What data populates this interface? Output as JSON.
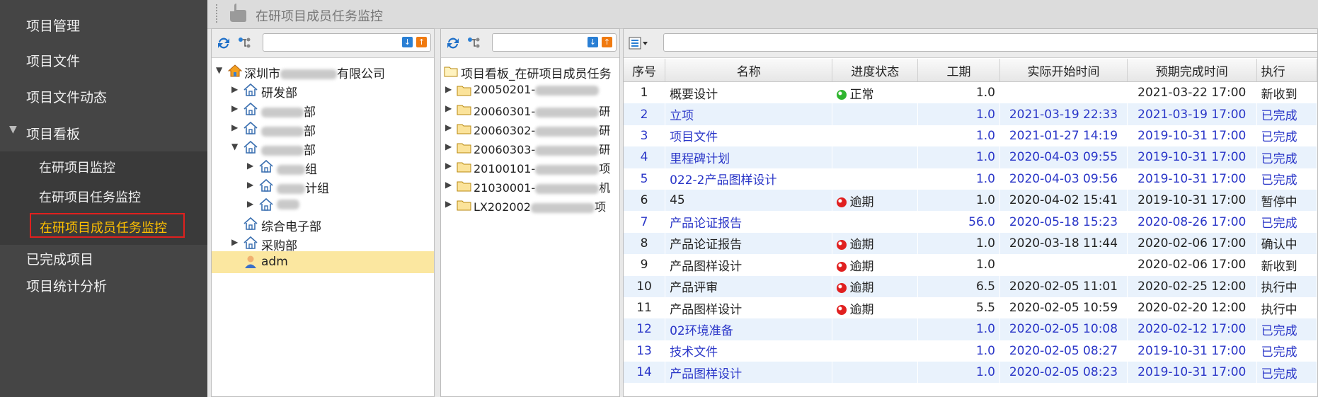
{
  "sidebar": {
    "items": [
      {
        "label": "项目管理"
      },
      {
        "label": "项目文件"
      },
      {
        "label": "项目文件动态"
      },
      {
        "label": "项目看板"
      },
      {
        "label": "已完成项目"
      },
      {
        "label": "项目统计分析"
      }
    ],
    "sub_items": [
      {
        "label": "在研项目监控"
      },
      {
        "label": "在研项目任务监控"
      },
      {
        "label": "在研项目成员任务监控"
      }
    ]
  },
  "titlebar": {
    "title": "在研项目成员任务监控"
  },
  "org_tree": {
    "root": "深圳市",
    "root_suffix": "有限公司",
    "nodes": [
      {
        "label": "研发部"
      },
      {
        "label": "部"
      },
      {
        "label": "部"
      },
      {
        "label": "部"
      },
      {
        "label": "组"
      },
      {
        "label": "计组"
      },
      {
        "label": ""
      },
      {
        "label": "综合电子部"
      },
      {
        "label": "采购部"
      },
      {
        "label": "adm"
      }
    ]
  },
  "project_tree": {
    "root": "项目看板_在研项目成员任务",
    "folders": [
      {
        "code": "20050201-",
        "suffix": ""
      },
      {
        "code": "20060301-",
        "suffix": "研"
      },
      {
        "code": "20060302-",
        "suffix": "研"
      },
      {
        "code": "20060303-",
        "suffix": "研"
      },
      {
        "code": "20100101-",
        "suffix": "项"
      },
      {
        "code": "21030001-",
        "suffix": "机"
      },
      {
        "code": "LX202002",
        "suffix": "项"
      }
    ]
  },
  "table": {
    "headers": [
      "序号",
      "名称",
      "进度状态",
      "工期",
      "实际开始时间",
      "预期完成时间",
      "执行"
    ],
    "rows": [
      {
        "no": "1",
        "name": "概要设计",
        "status": "正常",
        "status_color": "#2fb52f",
        "days": "1.0",
        "start": "",
        "due": "2021-03-22 17:00",
        "exec": "新收到",
        "done": false
      },
      {
        "no": "2",
        "name": "立项",
        "status": "",
        "status_color": "",
        "days": "1.0",
        "start": "2021-03-19 22:33",
        "due": "2021-03-19 17:00",
        "exec": "已完成",
        "done": true
      },
      {
        "no": "3",
        "name": "项目文件",
        "status": "",
        "status_color": "",
        "days": "1.0",
        "start": "2021-01-27 14:19",
        "due": "2019-10-31 17:00",
        "exec": "已完成",
        "done": true
      },
      {
        "no": "4",
        "name": "里程碑计划",
        "status": "",
        "status_color": "",
        "days": "1.0",
        "start": "2020-04-03 09:55",
        "due": "2019-10-31 17:00",
        "exec": "已完成",
        "done": true
      },
      {
        "no": "5",
        "name": "022-2产品图样设计",
        "status": "",
        "status_color": "",
        "days": "1.0",
        "start": "2020-04-03 09:56",
        "due": "2019-10-31 17:00",
        "exec": "已完成",
        "done": true
      },
      {
        "no": "6",
        "name": "45",
        "status": "逾期",
        "status_color": "#e02020",
        "days": "1.0",
        "start": "2020-04-02 15:41",
        "due": "2019-10-31 17:00",
        "exec": "暂停中",
        "done": false
      },
      {
        "no": "7",
        "name": "产品论证报告",
        "status": "",
        "status_color": "",
        "days": "56.0",
        "start": "2020-05-18 15:23",
        "due": "2020-08-26 17:00",
        "exec": "已完成",
        "done": true
      },
      {
        "no": "8",
        "name": "产品论证报告",
        "status": "逾期",
        "status_color": "#e02020",
        "days": "1.0",
        "start": "2020-03-18 11:44",
        "due": "2020-02-06 17:00",
        "exec": "确认中",
        "done": false
      },
      {
        "no": "9",
        "name": "产品图样设计",
        "status": "逾期",
        "status_color": "#e02020",
        "days": "1.0",
        "start": "",
        "due": "2020-02-06 17:00",
        "exec": "新收到",
        "done": false
      },
      {
        "no": "10",
        "name": "产品评审",
        "status": "逾期",
        "status_color": "#e02020",
        "days": "6.5",
        "start": "2020-02-05 11:01",
        "due": "2020-02-25 12:00",
        "exec": "执行中",
        "done": false
      },
      {
        "no": "11",
        "name": "产品图样设计",
        "status": "逾期",
        "status_color": "#e02020",
        "days": "5.5",
        "start": "2020-02-05 10:59",
        "due": "2020-02-20 12:00",
        "exec": "执行中",
        "done": false
      },
      {
        "no": "12",
        "name": "02环境准备",
        "status": "",
        "status_color": "",
        "days": "1.0",
        "start": "2020-02-05 10:08",
        "due": "2020-02-12 17:00",
        "exec": "已完成",
        "done": true
      },
      {
        "no": "13",
        "name": "技术文件",
        "status": "",
        "status_color": "",
        "days": "1.0",
        "start": "2020-02-05 08:27",
        "due": "2019-10-31 17:00",
        "exec": "已完成",
        "done": true
      },
      {
        "no": "14",
        "name": "产品图样设计",
        "status": "",
        "status_color": "",
        "days": "1.0",
        "start": "2020-02-05 08:23",
        "due": "2019-10-31 17:00",
        "exec": "已完成",
        "done": true
      }
    ]
  }
}
